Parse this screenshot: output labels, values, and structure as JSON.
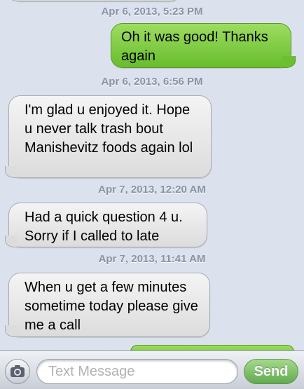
{
  "thread": {
    "items": [
      {
        "kind": "timestamp",
        "text": "Apr 6, 2013, 5:23 PM"
      },
      {
        "kind": "sent",
        "text": "Oh it was good! Thanks again"
      },
      {
        "kind": "timestamp",
        "text": "Apr 6, 2013, 6:56 PM"
      },
      {
        "kind": "received",
        "text": "I'm glad u enjoyed it. Hope u never talk trash bout Manishevitz foods again lol"
      },
      {
        "kind": "timestamp",
        "text": "Apr 7, 2013, 12:20 AM"
      },
      {
        "kind": "received",
        "text": "Had a quick question 4 u. Sorry if I called to late"
      },
      {
        "kind": "timestamp",
        "text": "Apr 7, 2013, 11:41 AM"
      },
      {
        "kind": "received",
        "text": "When u get a few minutes sometime today please give me a call"
      }
    ]
  },
  "composer": {
    "camera_icon": "camera-icon",
    "placeholder": "Text Message",
    "send_label": "Send"
  },
  "colors": {
    "background": "#dbe2ed",
    "sent_bubble": "#7fcc45",
    "received_bubble": "#e8e8e8",
    "timestamp": "#8a93a4",
    "send_button": "#4caa2c"
  }
}
